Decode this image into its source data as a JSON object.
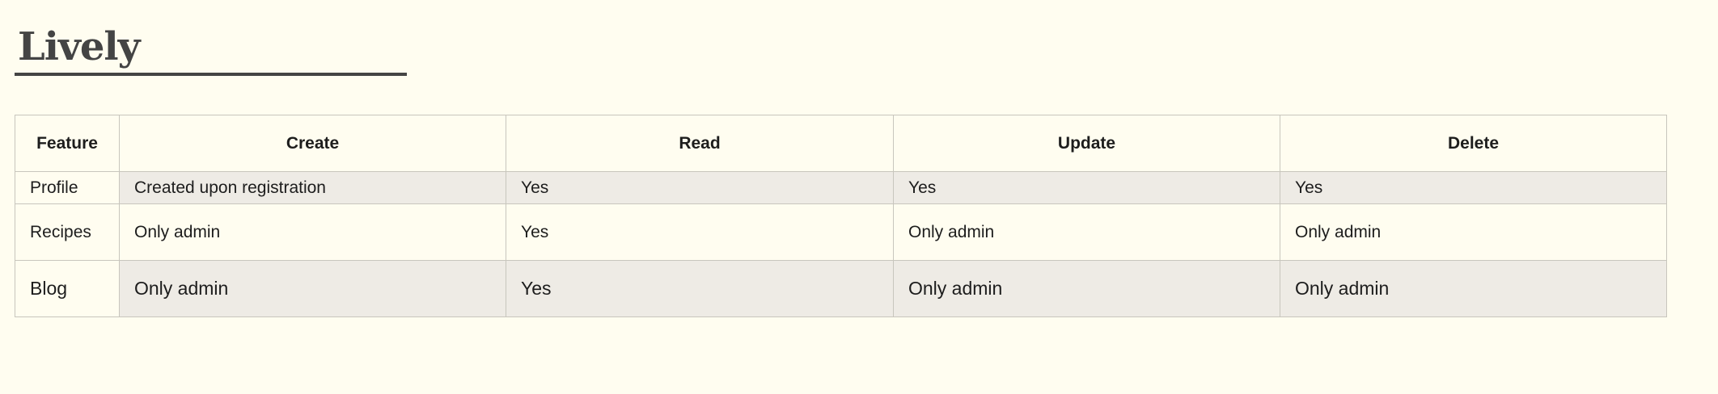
{
  "title": "Lively",
  "table": {
    "headers": [
      "Feature",
      "Create",
      "Read",
      "Update",
      "Delete"
    ],
    "rows": [
      [
        "Profile",
        "Created upon registration",
        "Yes",
        "Yes",
        "Yes"
      ],
      [
        "Recipes",
        "Only admin",
        "Yes",
        "Only admin",
        "Only admin"
      ],
      [
        "Blog",
        "Only admin",
        "Yes",
        "Only admin",
        "Only admin"
      ]
    ]
  }
}
